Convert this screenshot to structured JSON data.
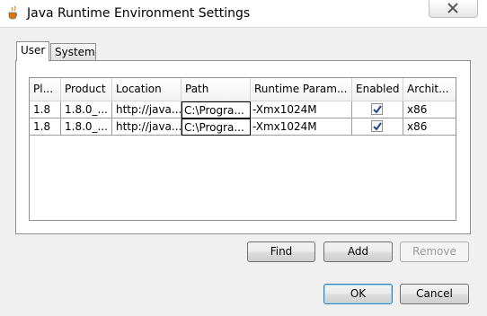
{
  "window": {
    "title": "Java Runtime Environment Settings",
    "icon": "java-cup-icon",
    "close_icon": "close-icon"
  },
  "tabs": [
    {
      "label": "User",
      "selected": true
    },
    {
      "label": "System",
      "selected": false
    }
  ],
  "table": {
    "headers": [
      "Pl...",
      "Product",
      "Location",
      "Path",
      "Runtime Param...",
      "Enabled",
      "Archit..."
    ],
    "rows": [
      {
        "platform": "1.8",
        "product": "1.8.0_...",
        "location": "http://java...",
        "path": "C:\\Progra...",
        "runtime_params": "-Xmx1024M",
        "enabled": true,
        "arch": "x86"
      },
      {
        "platform": "1.8",
        "product": "1.8.0_...",
        "location": "http://java...",
        "path": "C:\\Progra...",
        "runtime_params": "-Xmx1024M",
        "enabled": true,
        "arch": "x86"
      }
    ]
  },
  "buttons": {
    "find": "Find",
    "add": "Add",
    "remove": "Remove",
    "ok": "OK",
    "cancel": "Cancel"
  },
  "colors": {
    "check": "#21468c",
    "default_button_border": "#3c7fb1"
  }
}
